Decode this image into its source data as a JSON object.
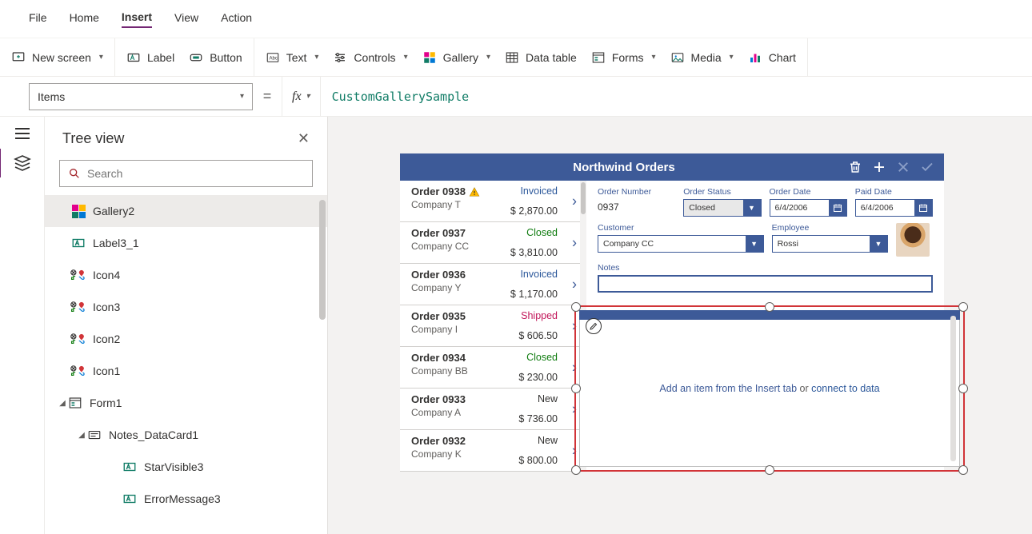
{
  "menu": {
    "file": "File",
    "home": "Home",
    "insert": "Insert",
    "view": "View",
    "action": "Action"
  },
  "ribbon": {
    "newscreen": "New screen",
    "label": "Label",
    "button": "Button",
    "text": "Text",
    "controls": "Controls",
    "gallery": "Gallery",
    "datatable": "Data table",
    "forms": "Forms",
    "media": "Media",
    "charts": "Chart"
  },
  "formula": {
    "property": "Items",
    "value": "CustomGallerySample"
  },
  "tree": {
    "title": "Tree view",
    "search_ph": "Search",
    "nodes": {
      "gallery2": "Gallery2",
      "label3_1": "Label3_1",
      "icon4": "Icon4",
      "icon3": "Icon3",
      "icon2": "Icon2",
      "icon1": "Icon1",
      "form1": "Form1",
      "notesdc": "Notes_DataCard1",
      "starvis": "StarVisible3",
      "errmsg": "ErrorMessage3"
    }
  },
  "app": {
    "title": "Northwind Orders",
    "orders": [
      {
        "id": "Order 0938",
        "company": "Company T",
        "status": "Invoiced",
        "amount": "$ 2,870.00",
        "warn": true
      },
      {
        "id": "Order 0937",
        "company": "Company CC",
        "status": "Closed",
        "amount": "$ 3,810.00"
      },
      {
        "id": "Order 0936",
        "company": "Company Y",
        "status": "Invoiced",
        "amount": "$ 1,170.00"
      },
      {
        "id": "Order 0935",
        "company": "Company I",
        "status": "Shipped",
        "amount": "$ 606.50"
      },
      {
        "id": "Order 0934",
        "company": "Company BB",
        "status": "Closed",
        "amount": "$ 230.00"
      },
      {
        "id": "Order 0933",
        "company": "Company A",
        "status": "New",
        "amount": "$ 736.00"
      },
      {
        "id": "Order 0932",
        "company": "Company K",
        "status": "New",
        "amount": "$ 800.00"
      }
    ],
    "form": {
      "lbl_ordnum": "Order Number",
      "ordnum": "0937",
      "lbl_status": "Order Status",
      "status": "Closed",
      "lbl_orddate": "Order Date",
      "orddate": "6/4/2006",
      "lbl_paiddate": "Paid Date",
      "paiddate": "6/4/2006",
      "lbl_customer": "Customer",
      "customer": "Company CC",
      "lbl_employee": "Employee",
      "employee": "Rossi",
      "lbl_notes": "Notes"
    },
    "gallery_msg": {
      "pre": "Add an item from the Insert tab",
      "or": " or ",
      "link": "connect to data"
    }
  }
}
